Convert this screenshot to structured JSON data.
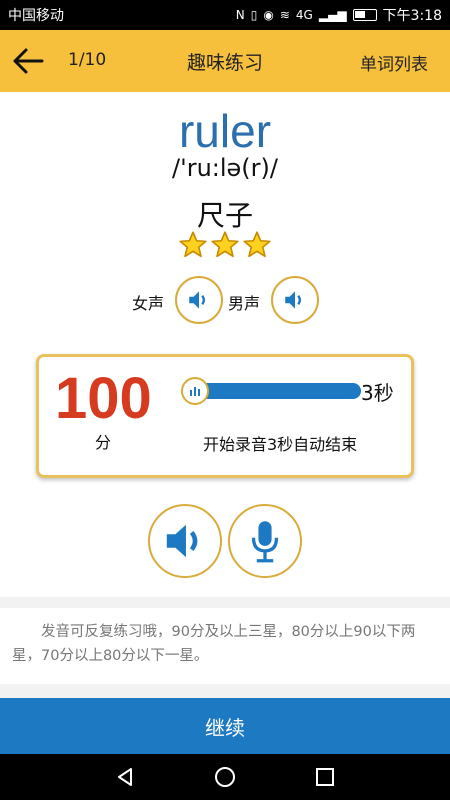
{
  "status_bar": {
    "carrier": "中国移动",
    "network": "4G",
    "time": "下午3:18"
  },
  "header": {
    "progress": "1/10",
    "title": "趣味练习",
    "word_list": "单词列表"
  },
  "word": {
    "text": "ruler",
    "phonetic": "/'ru:lə(r)/",
    "meaning": "尺子",
    "stars": 3
  },
  "voices": {
    "female_label": "女声",
    "male_label": "男声"
  },
  "score": {
    "value": "100",
    "unit": "分",
    "seconds": "3秒",
    "hint": "开始录音3秒自动结束"
  },
  "tip": {
    "text": "发音可反复练习哦，90分及以上三星，80分以上90以下两星，70分以上80分以下一星。"
  },
  "footer": {
    "continue_label": "继续"
  },
  "colors": {
    "accent": "#f6bf3c",
    "primary": "#1e79c3",
    "score": "#d63b1f",
    "ring": "#d9ab3a"
  },
  "icons": [
    "back-arrow-icon",
    "star-icon",
    "speaker-icon",
    "microphone-icon",
    "nav-back-icon",
    "nav-home-icon",
    "nav-recents-icon"
  ]
}
